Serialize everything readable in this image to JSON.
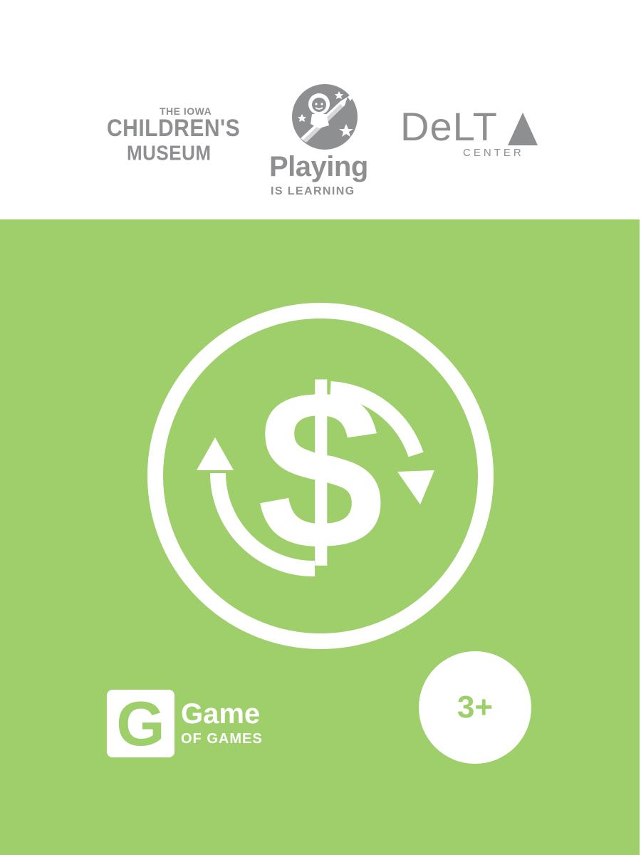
{
  "colors": {
    "card_green": "#9ecf6a",
    "logo_gray": "#8e8f91",
    "white": "#ffffff"
  },
  "header": {
    "logos": {
      "iowa_childrens_museum": {
        "line1": "THE IOWA",
        "line2": "CHILDREN'S",
        "line3": "MUSEUM"
      },
      "playing_is_learning": {
        "title": "Playing",
        "subtitle": "IS LEARNING",
        "emblem_icon": "astronaut-on-pencil-icon"
      },
      "delta_center": {
        "word": "DeLT",
        "subtitle": "CENTER",
        "mark_icon": "triangle-icon"
      }
    }
  },
  "card": {
    "main_icon": "money-exchange-icon",
    "symbol": "$",
    "brand": {
      "badge_letter": "G",
      "title": "Game",
      "subtitle": "OF GAMES"
    },
    "age_badge": "3+"
  }
}
